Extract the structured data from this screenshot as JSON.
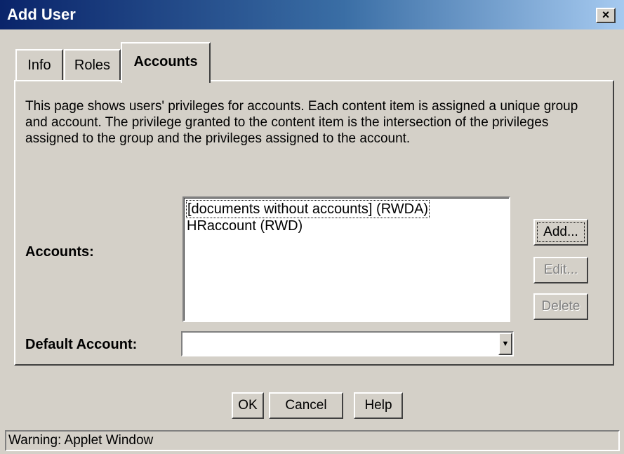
{
  "window": {
    "title": "Add User",
    "close_label": "×"
  },
  "tabs": [
    {
      "label": "Info"
    },
    {
      "label": "Roles"
    },
    {
      "label": "Accounts",
      "selected": true
    }
  ],
  "panel": {
    "description": "This page shows users' privileges for accounts. Each content item is assigned a unique group and account. The privilege granted to the content item is the intersection of the privileges assigned to the group and the privileges assigned to the account.",
    "accounts_label": "Accounts:",
    "accounts_list": [
      "[documents without accounts] (RWDA)",
      "HRaccount (RWD)"
    ],
    "default_account_label": "Default Account:",
    "default_account_value": "",
    "buttons": {
      "add": "Add...",
      "edit": "Edit...",
      "delete": "Delete"
    }
  },
  "footer": {
    "ok": "OK",
    "cancel": "Cancel",
    "help": "Help"
  },
  "status_bar": "Warning: Applet Window",
  "icons": {
    "close": "close-icon",
    "dropdown": "chevron-down-icon"
  },
  "colors": {
    "title_start": "#0a246a",
    "title_end": "#a6caf0",
    "face": "#d4d0c8"
  }
}
